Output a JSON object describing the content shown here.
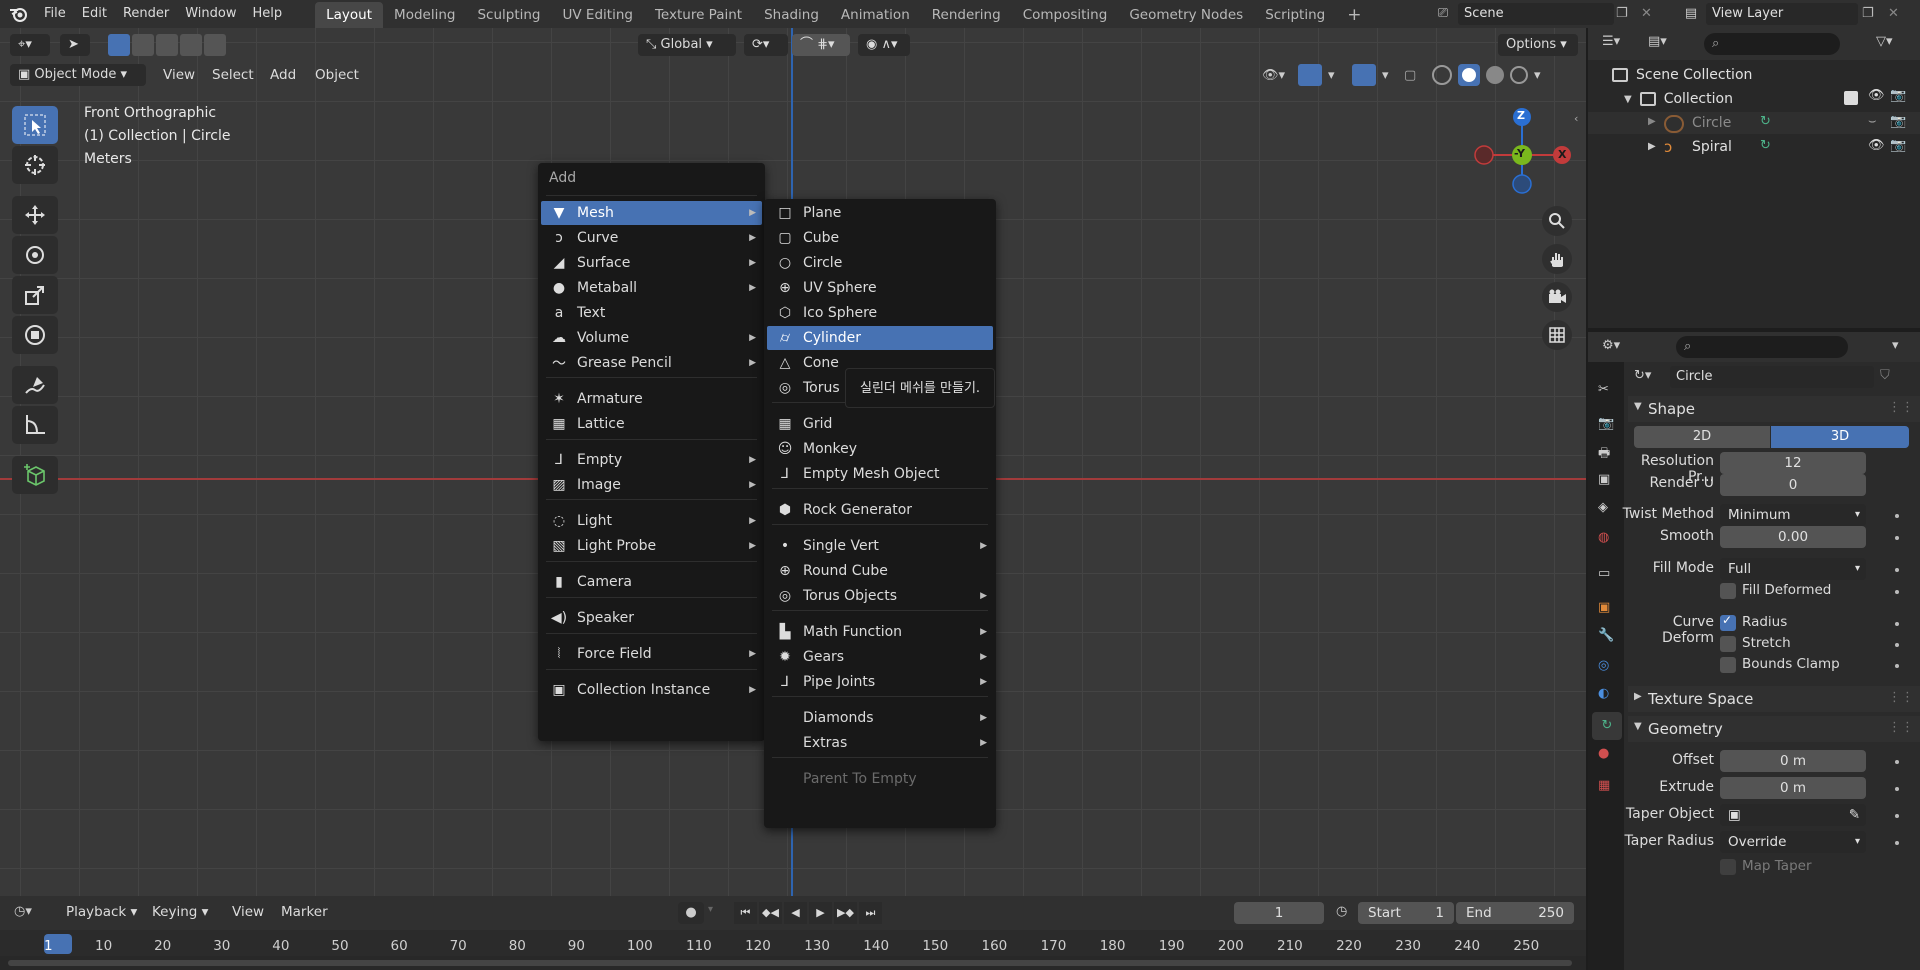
{
  "topbar": {
    "menus": [
      "File",
      "Edit",
      "Render",
      "Window",
      "Help"
    ],
    "workspaces": [
      "Layout",
      "Modeling",
      "Sculpting",
      "UV Editing",
      "Texture Paint",
      "Shading",
      "Animation",
      "Rendering",
      "Compositing",
      "Geometry Nodes",
      "Scripting"
    ],
    "active_workspace": "Layout",
    "scene": "Scene",
    "view_layer": "View Layer"
  },
  "viewport_header": {
    "mode": "Object Mode",
    "menus": [
      "View",
      "Select",
      "Add",
      "Object"
    ],
    "transform": "Global",
    "options": "Options"
  },
  "viewport_overlay": {
    "view_name": "Front Orthographic",
    "collection": "(1) Collection | Circle",
    "units": "Meters"
  },
  "gizmo": {
    "z": "Z",
    "y": "-Y",
    "x": "X"
  },
  "add_menu": {
    "title": "Add",
    "items": [
      {
        "label": "Mesh",
        "icon": "mesh-icon",
        "sub": true
      },
      {
        "label": "Curve",
        "icon": "curve-icon",
        "sub": true
      },
      {
        "label": "Surface",
        "icon": "surface-icon",
        "sub": true
      },
      {
        "label": "Metaball",
        "icon": "metaball-icon",
        "sub": true
      },
      {
        "label": "Text",
        "icon": "text-icon",
        "sub": false
      },
      {
        "label": "Volume",
        "icon": "volume-icon",
        "sub": true
      },
      {
        "label": "Grease Pencil",
        "icon": "grease-pencil-icon",
        "sub": true
      },
      {
        "label": "Armature",
        "icon": "armature-icon",
        "sub": false
      },
      {
        "label": "Lattice",
        "icon": "lattice-icon",
        "sub": false
      },
      {
        "label": "Empty",
        "icon": "empty-icon",
        "sub": true
      },
      {
        "label": "Image",
        "icon": "image-icon",
        "sub": true
      },
      {
        "label": "Light",
        "icon": "light-icon",
        "sub": true
      },
      {
        "label": "Light Probe",
        "icon": "light-probe-icon",
        "sub": true
      },
      {
        "label": "Camera",
        "icon": "camera-icon",
        "sub": false
      },
      {
        "label": "Speaker",
        "icon": "speaker-icon",
        "sub": false
      },
      {
        "label": "Force Field",
        "icon": "force-field-icon",
        "sub": true
      },
      {
        "label": "Collection Instance",
        "icon": "collection-instance-icon",
        "sub": true
      }
    ]
  },
  "mesh_menu": {
    "items": [
      {
        "label": "Plane",
        "icon": "plane-icon"
      },
      {
        "label": "Cube",
        "icon": "cube-icon"
      },
      {
        "label": "Circle",
        "icon": "circle-icon"
      },
      {
        "label": "UV Sphere",
        "icon": "uv-sphere-icon"
      },
      {
        "label": "Ico Sphere",
        "icon": "ico-sphere-icon"
      },
      {
        "label": "Cylinder",
        "icon": "cylinder-icon"
      },
      {
        "label": "Cone",
        "icon": "cone-icon"
      },
      {
        "label": "Torus",
        "icon": "torus-icon"
      },
      {
        "label": "Grid",
        "icon": "grid-icon"
      },
      {
        "label": "Monkey",
        "icon": "monkey-icon"
      },
      {
        "label": "Empty Mesh Object",
        "icon": "empty-mesh-icon"
      },
      {
        "label": "Rock Generator",
        "icon": "rock-icon"
      },
      {
        "label": "Single Vert",
        "icon": "vert-icon"
      },
      {
        "label": "Round Cube",
        "icon": "round-cube-icon"
      },
      {
        "label": "Torus Objects",
        "icon": "torus-objects-icon"
      },
      {
        "label": "Math Function",
        "icon": "math-icon"
      },
      {
        "label": "Gears",
        "icon": "gears-icon"
      },
      {
        "label": "Pipe Joints",
        "icon": "pipe-icon"
      },
      {
        "label": "Diamonds",
        "icon": ""
      },
      {
        "label": "Extras",
        "icon": ""
      },
      {
        "label": "Parent To Empty",
        "icon": ""
      }
    ],
    "highlighted": "Cylinder"
  },
  "tooltip": "실린더 메쉬를 만들기.",
  "outliner": {
    "scene_collection": "Scene Collection",
    "collection": "Collection",
    "objects": [
      "Circle",
      "Spiral"
    ]
  },
  "properties": {
    "object_name": "Circle",
    "shape": {
      "title": "Shape",
      "mode_2d": "2D",
      "mode_3d": "3D",
      "resolution_label": "Resolution Pr...",
      "resolution_value": "12",
      "render_u_label": "Render U",
      "render_u_value": "0",
      "twist_label": "Twist Method",
      "twist_value": "Minimum",
      "smooth_label": "Smooth",
      "smooth_value": "0.00",
      "fill_label": "Fill Mode",
      "fill_value": "Full",
      "fill_deformed": "Fill Deformed",
      "curve_deform_label": "Curve Deform",
      "radius": "Radius",
      "stretch": "Stretch",
      "bounds_clamp": "Bounds Clamp"
    },
    "texture_space": "Texture Space",
    "geometry": {
      "title": "Geometry",
      "offset_label": "Offset",
      "offset_value": "0 m",
      "extrude_label": "Extrude",
      "extrude_value": "0 m",
      "taper_object_label": "Taper Object",
      "taper_radius_label": "Taper Radius",
      "taper_radius_value": "Override",
      "map_taper": "Map Taper"
    }
  },
  "timeline": {
    "menus": [
      "Playback",
      "Keying",
      "View",
      "Marker"
    ],
    "current_frame": "1",
    "start_label": "Start",
    "start_value": "1",
    "end_label": "End",
    "end_value": "250",
    "ticks": [
      "1",
      "10",
      "20",
      "30",
      "40",
      "50",
      "60",
      "70",
      "80",
      "90",
      "100",
      "110",
      "120",
      "130",
      "140",
      "150",
      "160",
      "170",
      "180",
      "190",
      "200",
      "210",
      "220",
      "230",
      "240",
      "250"
    ]
  },
  "colors": {
    "accent": "#4772b3",
    "axis_x": "#c23b3b",
    "axis_y": "#7ab81d",
    "axis_z": "#2a6fd3"
  }
}
